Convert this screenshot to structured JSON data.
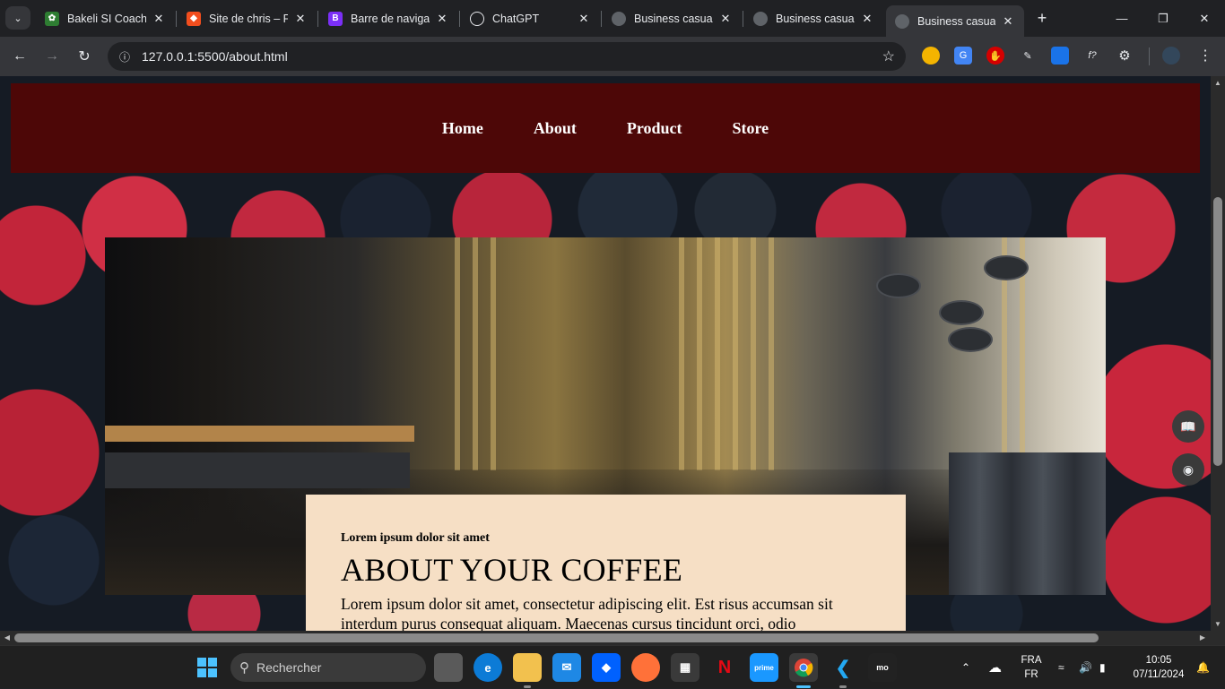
{
  "browser": {
    "tabs": [
      {
        "title": "Bakeli SI Coaching",
        "favicon": "bakeli-icon",
        "color": "#2e7d32"
      },
      {
        "title": "Site de chris – Figma",
        "favicon": "figma-icon",
        "color": "#f24e1e"
      },
      {
        "title": "Barre de navigation",
        "favicon": "bootstrap-icon",
        "color": "#7b2ff7"
      },
      {
        "title": "ChatGPT",
        "favicon": "chatgpt-icon",
        "color": "#202124"
      },
      {
        "title": "Business casual",
        "favicon": "globe-icon",
        "color": "#5f6368"
      },
      {
        "title": "Business casual",
        "favicon": "globe-icon",
        "color": "#5f6368"
      },
      {
        "title": "Business casual",
        "favicon": "globe-icon",
        "color": "#5f6368"
      }
    ],
    "active_tab_index": 6,
    "url": "127.0.0.1:5500/about.html",
    "favicon_letters": {
      "bootstrap": "B"
    }
  },
  "site": {
    "nav": [
      "Home",
      "About",
      "Product",
      "Store"
    ],
    "card": {
      "eyebrow": "Lorem ipsum dolor sit amet",
      "heading": "ABOUT YOUR COFFEE",
      "body": "Lorem ipsum dolor sit amet, consectetur adipiscing elit. Est risus accumsan sit interdum purus consequat aliquam. Maecenas cursus tincidunt orci, odio"
    },
    "colors": {
      "nav_bg": "#4d0707",
      "card_bg": "#f6dfc5"
    }
  },
  "taskbar": {
    "search_placeholder": "Rechercher",
    "lang_top": "FRA",
    "lang_bottom": "FR",
    "time": "10:05",
    "date": "07/11/2024"
  }
}
